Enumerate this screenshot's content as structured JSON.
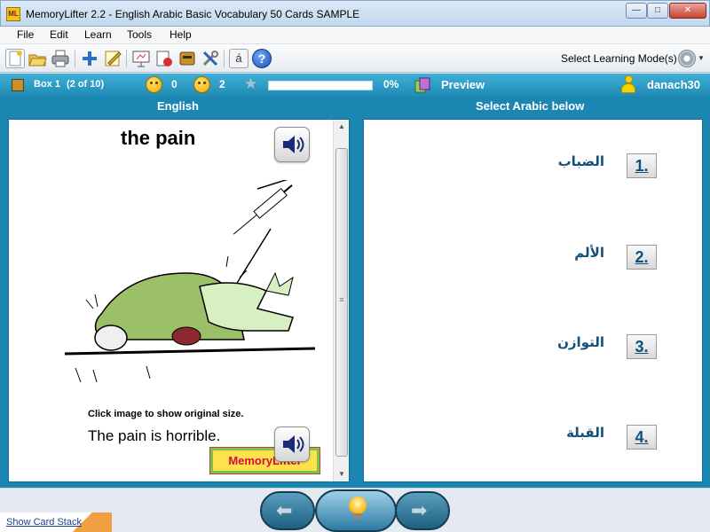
{
  "window": {
    "app_icon_text": "ML",
    "title": "MemoryLifter 2.2 - English Arabic Basic Vocabulary 50 Cards SAMPLE",
    "minimize": "—",
    "maximize": "□",
    "close": "✕"
  },
  "menu": {
    "file": "File",
    "edit": "Edit",
    "learn": "Learn",
    "tools": "Tools",
    "help": "Help"
  },
  "toolbar": {
    "accent_char": "á",
    "help_char": "?",
    "learning_mode_label": "Select Learning Mode(s)"
  },
  "status": {
    "box_label": "Box 1",
    "box_position": "(2 of 10)",
    "correct_count": "0",
    "wrong_count": "2",
    "progress_percent_text": "0%",
    "progress_value": 0,
    "preview_label": "Preview",
    "username": "danach30"
  },
  "question": {
    "header": "English",
    "word": "the pain",
    "click_note": "Click image to show original size.",
    "example": "The pain is horrible.",
    "logo_text": "MemoryLifter"
  },
  "answers": {
    "header": "Select Arabic below",
    "choices": [
      {
        "text": "الضباب",
        "number": "1."
      },
      {
        "text": "الألم",
        "number": "2."
      },
      {
        "text": "التوازن",
        "number": "3."
      },
      {
        "text": "القبلة",
        "number": "4."
      }
    ]
  },
  "bottom": {
    "show_card_stack": "Show Card Stack"
  },
  "colors": {
    "accent": "#1c86b3",
    "answer_text": "#12507a",
    "progress_fill": "#7ecb4a"
  }
}
